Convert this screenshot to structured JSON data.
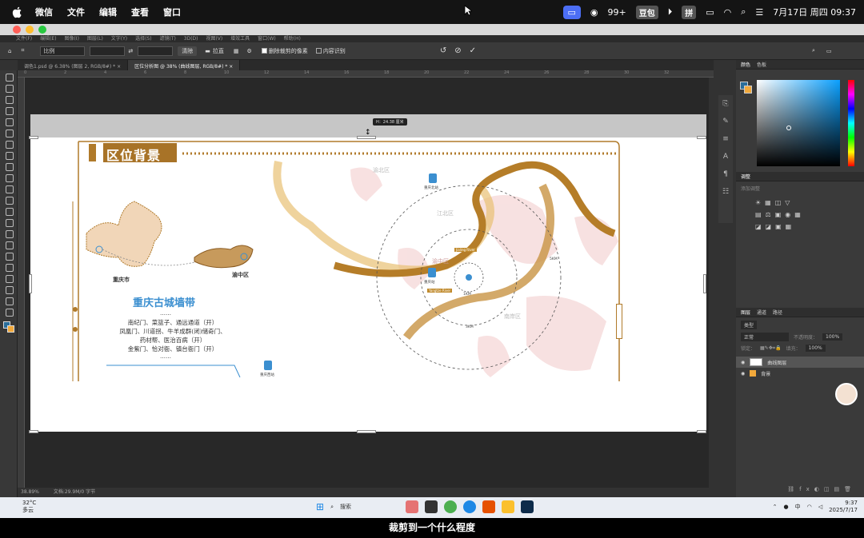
{
  "menubar": {
    "items": [
      "微信",
      "文件",
      "编辑",
      "查看",
      "窗口"
    ],
    "badge": "99+",
    "pill": "豆包",
    "input_method": "拼",
    "datetime": "7月17日 周四 09:37"
  },
  "photoshop": {
    "menu": [
      "文件(F)",
      "编辑(E)",
      "图像(I)",
      "图层(L)",
      "文字(Y)",
      "选择(S)",
      "滤镜(T)",
      "3D(D)",
      "视图(V)",
      "增效工具",
      "窗口(W)",
      "帮助(H)"
    ],
    "options": {
      "ratio": "比例",
      "clear": "清除",
      "straighten": "拉直",
      "delete_cropped": "删除裁剪的像素",
      "content_aware": "内容识别"
    },
    "tabs": [
      {
        "label": "调色1.psd @ 6.38% (图层 2, RGB/8#) *",
        "active": false
      },
      {
        "label": "区位分析图 @ 38% (曲线图层, RGB/8#) *",
        "active": true
      }
    ],
    "ruler_marks": [
      "0",
      "2",
      "4",
      "6",
      "8",
      "10",
      "12",
      "14",
      "16",
      "18",
      "20",
      "22",
      "24",
      "26",
      "28",
      "30",
      "32"
    ],
    "crop_tooltip": "H：24.38 厘米",
    "status": {
      "zoom": "38.89%",
      "doc": "文档:29.9M/0 字节"
    }
  },
  "map": {
    "title": "区位背景",
    "city_label": "重庆市",
    "district_label": "渝中区",
    "wall_title": "重庆古城墙带",
    "wall_lines": [
      "南纪门、菜篮子、通远通道（开）",
      "凤凰门、川道拐、牛羊成群(闭)储奇门、",
      "药材帮、医治百病（开）",
      "金紫门、恰对衙、镇台衙门（开）"
    ],
    "ellipsis": "……",
    "place_labels": [
      "渝北区",
      "江北区",
      "渝中区",
      "南岸区"
    ],
    "ring_labels": [
      "1KM",
      "3KM",
      "5KM"
    ],
    "metro_labels": [
      "重庆北站",
      "重庆站",
      "重庆西站"
    ],
    "river_labels": [
      "Jialing River",
      "Yangtze River"
    ]
  },
  "right_panel": {
    "color_tabs": [
      "颜色",
      "色板"
    ],
    "adjust_tab": "调整",
    "adjust_hint": "添加调整",
    "layers_tabs": [
      "图层",
      "通道",
      "路径"
    ],
    "kind": "类型",
    "blend": "正常",
    "opacity_label": "不透明度：",
    "opacity": "100%",
    "lock_label": "锁定：",
    "fill_label": "填充：",
    "fill": "100%",
    "layers": [
      {
        "name": "曲线图层",
        "selected": true
      },
      {
        "name": "背景",
        "selected": false
      }
    ]
  },
  "taskbar": {
    "temp": "32°C",
    "weather": "多云",
    "search": "搜索",
    "ime": "中",
    "time": "9:37",
    "date": "2025/7/17"
  },
  "subtitle": "裁剪到一个什么程度",
  "colors": {
    "gold": "#b07a2a",
    "river": "#c08a2c",
    "blue_title": "#3b8fd0"
  }
}
